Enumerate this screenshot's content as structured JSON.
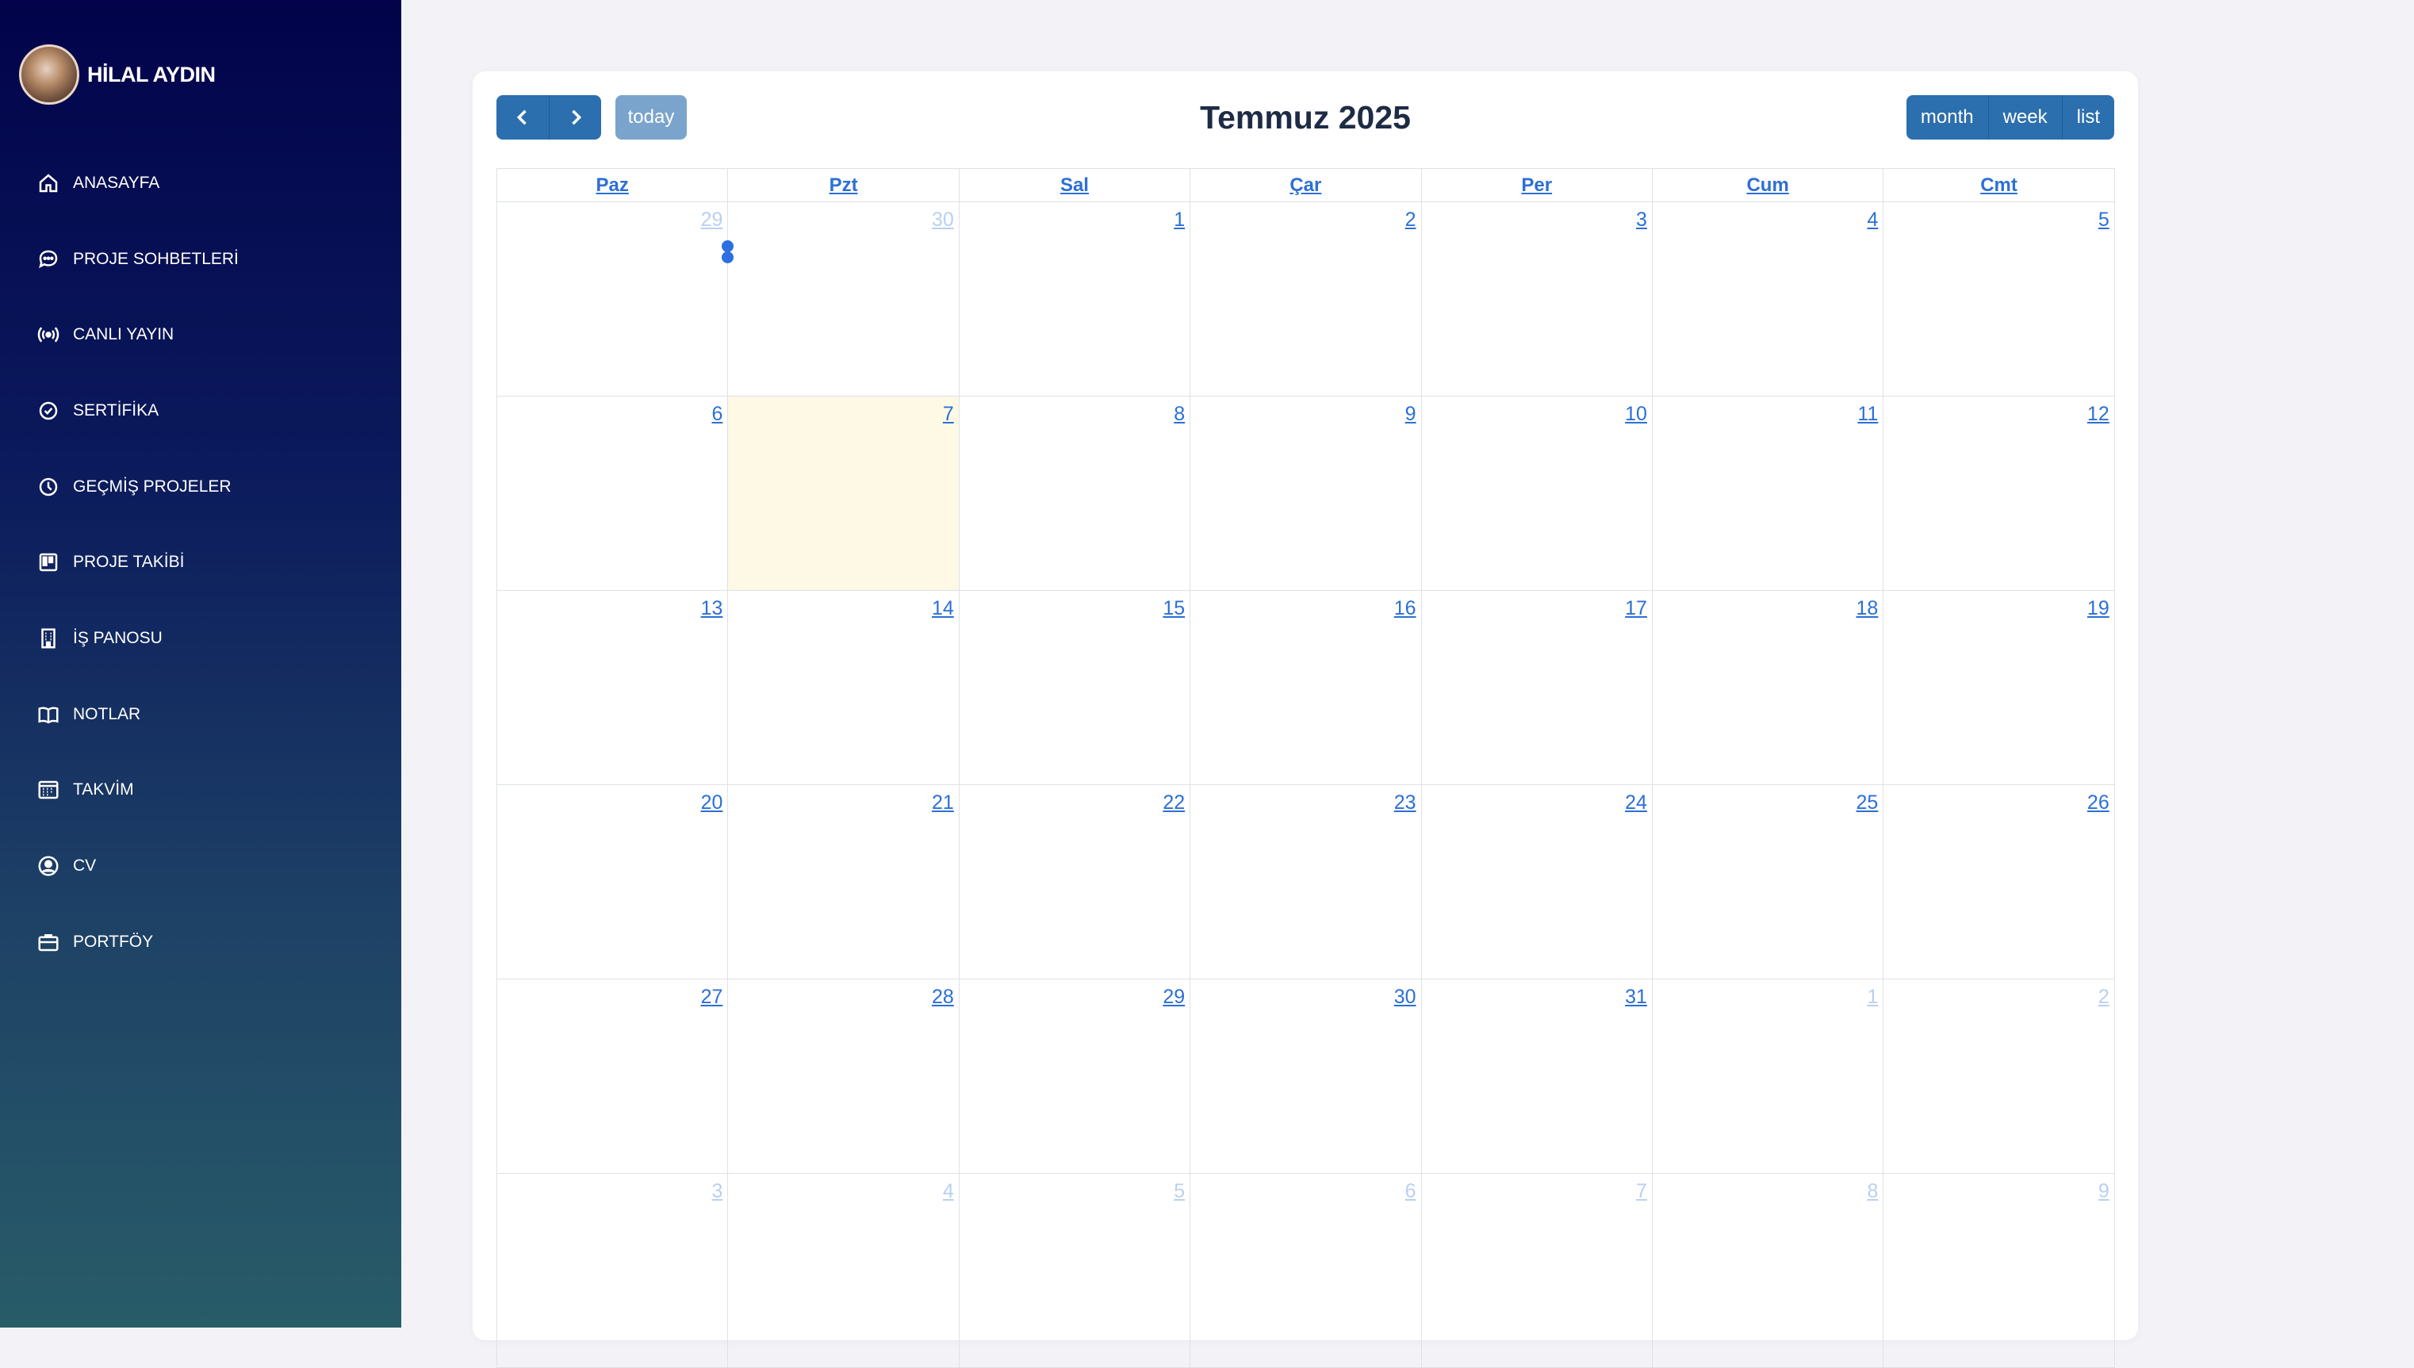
{
  "profile": {
    "name": "HİLAL AYDIN"
  },
  "sidebar": {
    "items": [
      {
        "label": "ANASAYFA",
        "icon": "home-icon"
      },
      {
        "label": "PROJE SOHBETLERİ",
        "icon": "chat-icon"
      },
      {
        "label": "CANLI YAYIN",
        "icon": "broadcast-icon"
      },
      {
        "label": "SERTİFİKA",
        "icon": "certificate-icon"
      },
      {
        "label": "GEÇMİŞ PROJELER",
        "icon": "history-icon"
      },
      {
        "label": "PROJE TAKİBİ",
        "icon": "kanban-icon"
      },
      {
        "label": "İŞ PANOSU",
        "icon": "building-icon"
      },
      {
        "label": "NOTLAR",
        "icon": "book-icon"
      },
      {
        "label": "TAKVİM",
        "icon": "calendar-icon"
      },
      {
        "label": "CV",
        "icon": "user-circle-icon"
      },
      {
        "label": "PORTFÖY",
        "icon": "briefcase-icon"
      }
    ]
  },
  "calendar": {
    "title": "Temmuz 2025",
    "today_label": "today",
    "views": [
      "month",
      "week",
      "list"
    ],
    "weekdays": [
      "Paz",
      "Pzt",
      "Sal",
      "Çar",
      "Per",
      "Cum",
      "Cmt"
    ],
    "weeks": [
      [
        {
          "d": "29",
          "o": true
        },
        {
          "d": "30",
          "o": true
        },
        {
          "d": "1"
        },
        {
          "d": "2"
        },
        {
          "d": "3"
        },
        {
          "d": "4"
        },
        {
          "d": "5"
        }
      ],
      [
        {
          "d": "6"
        },
        {
          "d": "7",
          "today": true
        },
        {
          "d": "8"
        },
        {
          "d": "9"
        },
        {
          "d": "10"
        },
        {
          "d": "11"
        },
        {
          "d": "12"
        }
      ],
      [
        {
          "d": "13"
        },
        {
          "d": "14"
        },
        {
          "d": "15"
        },
        {
          "d": "16"
        },
        {
          "d": "17"
        },
        {
          "d": "18"
        },
        {
          "d": "19"
        }
      ],
      [
        {
          "d": "20"
        },
        {
          "d": "21"
        },
        {
          "d": "22"
        },
        {
          "d": "23"
        },
        {
          "d": "24"
        },
        {
          "d": "25"
        },
        {
          "d": "26"
        }
      ],
      [
        {
          "d": "27"
        },
        {
          "d": "28"
        },
        {
          "d": "29"
        },
        {
          "d": "30"
        },
        {
          "d": "31"
        },
        {
          "d": "1",
          "o": true
        },
        {
          "d": "2",
          "o": true
        }
      ],
      [
        {
          "d": "3",
          "o": true
        },
        {
          "d": "4",
          "o": true
        },
        {
          "d": "5",
          "o": true
        },
        {
          "d": "6",
          "o": true
        },
        {
          "d": "7",
          "o": true
        },
        {
          "d": "8",
          "o": true
        },
        {
          "d": "9",
          "o": true
        }
      ]
    ],
    "event_markers": 2
  },
  "colors": {
    "accent": "#2c6fae",
    "link": "#2c6fd6",
    "today_bg": "#fef9e5",
    "event": "#2b6fe0"
  }
}
